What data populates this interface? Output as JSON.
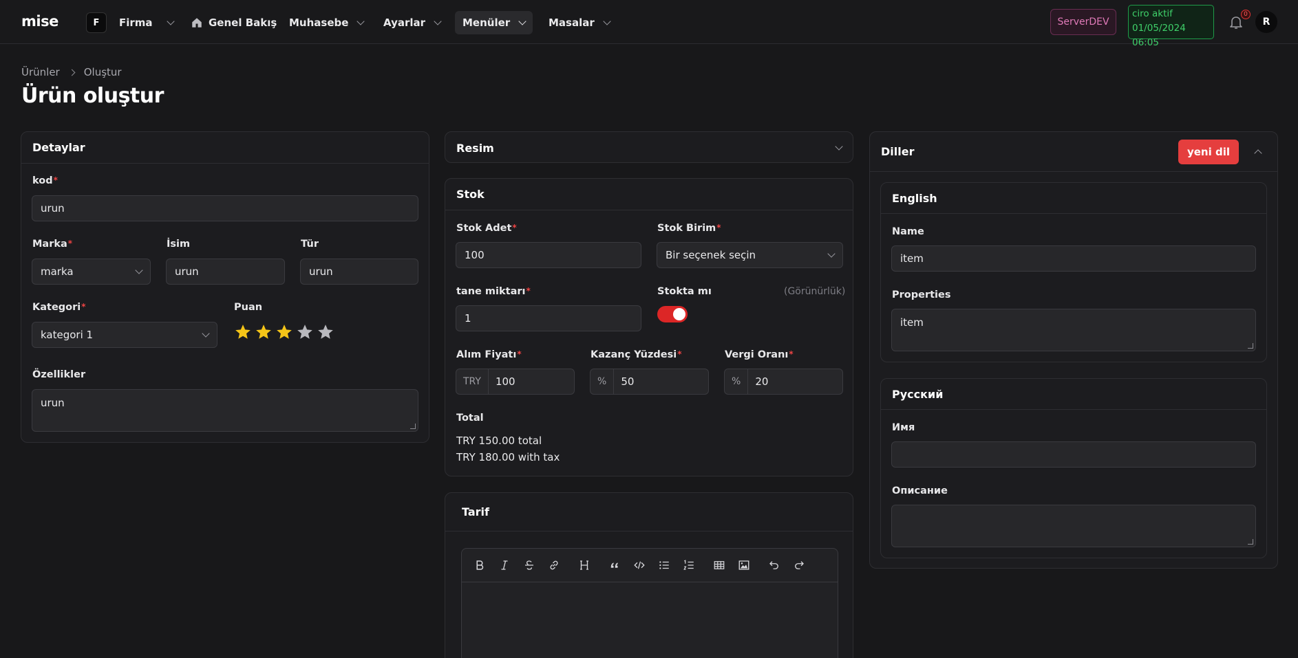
{
  "app": {
    "logo": "mise"
  },
  "nav": {
    "firm_letter": "F",
    "firm": "Firma",
    "overview": "Genel Bakış",
    "accounting": "Muhasebe",
    "settings": "Ayarlar",
    "menus": "Menüler",
    "tables": "Masalar"
  },
  "status": {
    "server": "ServerDEV",
    "ciro_line1": "ciro aktif",
    "ciro_line2": "01/05/2024 06:05",
    "notifications": "0",
    "user_initial": "R"
  },
  "breadcrumb": {
    "root": "Ürünler",
    "current": "Oluştur"
  },
  "page": {
    "title": "Ürün oluştur"
  },
  "details": {
    "title": "Detaylar",
    "code_label": "kod",
    "code_value": "urun",
    "brand_label": "Marka",
    "brand_value": "marka",
    "name_label": "İsim",
    "name_value": "urun",
    "type_label": "Tür",
    "type_value": "urun",
    "category_label": "Kategori",
    "category_value": "kategori 1",
    "rating_label": "Puan",
    "rating": 3,
    "rating_max": 5,
    "features_label": "Özellikler",
    "features_value": "urun"
  },
  "image": {
    "title": "Resim"
  },
  "stock": {
    "title": "Stok",
    "qty_label": "Stok Adet",
    "qty_value": "100",
    "unit_label": "Stok Birim",
    "unit_placeholder": "Bir seçenek seçin",
    "piece_label": "tane miktarı",
    "piece_value": "1",
    "in_stock_label": "Stokta mı",
    "visibility_hint": "(Görünürlük)",
    "in_stock": true,
    "buy_label": "Alım Fiyatı",
    "buy_prefix": "TRY",
    "buy_value": "100",
    "margin_label": "Kazanç Yüzdesi",
    "margin_prefix": "%",
    "margin_value": "50",
    "tax_label": "Vergi Oranı",
    "tax_prefix": "%",
    "tax_value": "20",
    "total_label": "Total",
    "total_line": "TRY 150.00 total",
    "tax_line": "TRY 180.00 with tax"
  },
  "recipe": {
    "title": "Tarif"
  },
  "languages": {
    "title": "Diller",
    "new_button": "yeni dil",
    "english": {
      "title": "English",
      "name_label": "Name",
      "name_value": "item",
      "props_label": "Properties",
      "props_value": "item"
    },
    "russian": {
      "title": "Русский",
      "name_label": "Имя",
      "name_value": "",
      "desc_label": "Описание",
      "desc_value": ""
    }
  },
  "colors": {
    "accent": "#e53e3e",
    "background": "#18181a",
    "card": "#1c1c1f",
    "success": "#3fd06a",
    "star": "#f5c518"
  }
}
